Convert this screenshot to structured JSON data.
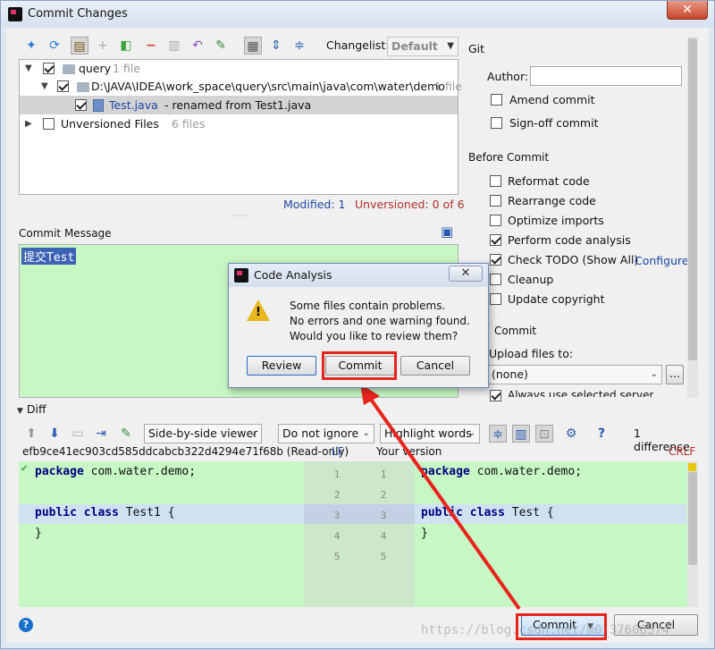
{
  "window": {
    "title": "Commit Changes",
    "close_glyph": "✕"
  },
  "toolbar": {
    "changelist_label": "Changelist:",
    "changelist_value": "Default",
    "icons": [
      "refresh-icon",
      "move-icon",
      "diff-icon",
      "add-icon",
      "group-icon",
      "remove-icon",
      "jump-icon",
      "revert-icon",
      "shelve-icon",
      "toggle-icon",
      "expand-icon",
      "collapse-icon"
    ]
  },
  "tree": {
    "root": {
      "label": "query",
      "count": "1 file"
    },
    "dir": {
      "label": "D:\\JAVA\\IDEA\\work_space\\query\\src\\main\\java\\com\\water\\demo",
      "count": "1 file"
    },
    "file": {
      "label": "Test.java",
      "note": "- renamed from Test1.java"
    },
    "unversioned": {
      "label": "Unversioned Files",
      "count": "6 files"
    }
  },
  "stats": {
    "modified": "Modified: 1",
    "unversioned": "Unversioned: 0 of 6"
  },
  "commit_message": {
    "label": "Commit Message",
    "text": "提交Test"
  },
  "git": {
    "section_label": "Git",
    "author_label": "Author:",
    "author_value": "",
    "amend": "Amend commit",
    "signoff": "Sign-off commit"
  },
  "before_commit": {
    "label": "Before Commit",
    "items": [
      {
        "label": "Reformat code",
        "checked": false
      },
      {
        "label": "Rearrange code",
        "checked": false
      },
      {
        "label": "Optimize imports",
        "checked": false
      },
      {
        "label": "Perform code analysis",
        "checked": true
      },
      {
        "label": "Check TODO (Show All)",
        "checked": true
      },
      {
        "label": "Cleanup",
        "checked": false
      },
      {
        "label": "Update copyright",
        "checked": false
      }
    ],
    "configure": "Configure"
  },
  "after_commit": {
    "label": "Commit",
    "upload_label": "Upload files to:",
    "upload_value": "(none)",
    "browse": "...",
    "always_label": "Always use selected server"
  },
  "dialog": {
    "title": "Code Analysis",
    "line1": "Some files contain problems.",
    "line2": "No errors and one warning found.",
    "line3": "Would you like to review them?",
    "review": "Review",
    "commit": "Commit",
    "cancel": "Cancel"
  },
  "diff": {
    "label": "Diff",
    "viewer": "Side-by-side viewer",
    "ignore": "Do not ignore",
    "highlight": "Highlight words",
    "count": "1 difference",
    "left_header": "efb9ce41ec903cd585ddcabcb322d4294e71f68b (Read-only)",
    "left_eol": "LF",
    "right_header": "Your version",
    "right_eol": "CRLF",
    "left_lines": [
      "package com.water.demo;",
      "",
      "public class Test1 {",
      "}",
      ""
    ],
    "right_lines": [
      "package com.water.demo;",
      "",
      "public class Test {",
      "}",
      ""
    ],
    "line_numbers": [
      "1",
      "2",
      "3",
      "4",
      "5"
    ]
  },
  "footer": {
    "commit": "Commit",
    "cancel": "Cancel",
    "help": "?",
    "watermark": "https://blog.csdn.net/m0_37606574"
  },
  "colors": {
    "accent_red": "#e8251d",
    "message_bg": "#c7f7c4",
    "link_blue": "#1d47a5"
  }
}
